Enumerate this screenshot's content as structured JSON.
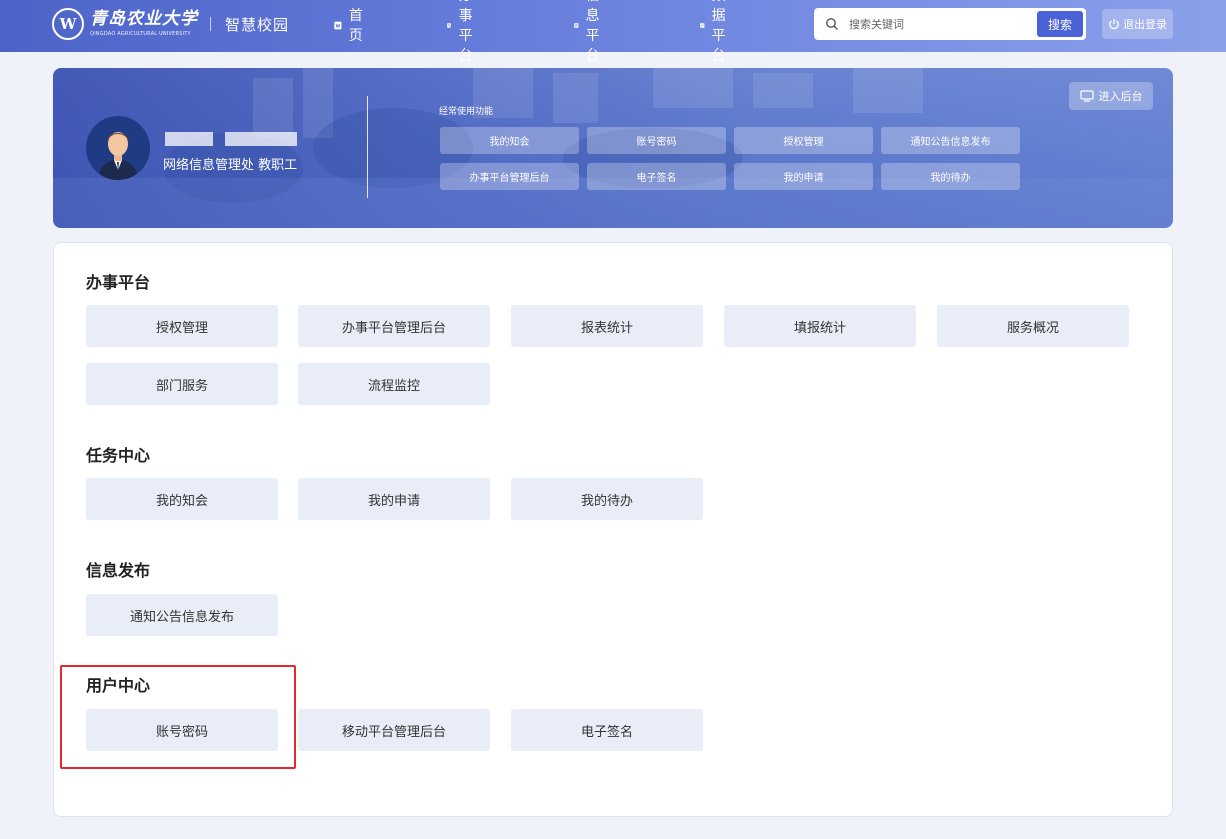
{
  "header": {
    "logo_cn": "青岛农业大学",
    "logo_en": "QINGDAO AGRICULTURAL UNIVERSITY",
    "system_name": "智慧校园",
    "nav": [
      {
        "label": "首页",
        "icon": "home-icon"
      },
      {
        "label": "办事平台",
        "icon": "edit-document-icon"
      },
      {
        "label": "信息平台",
        "icon": "info-document-icon"
      },
      {
        "label": "数据平台",
        "icon": "data-chart-icon"
      }
    ],
    "search": {
      "placeholder": "搜索关键词",
      "button_label": "搜索"
    },
    "logout_label": "退出登录"
  },
  "banner": {
    "user_dept": "网络信息管理处  教职工",
    "quick_title": "经常使用功能",
    "quick_items": [
      "我的知会",
      "账号密码",
      "授权管理",
      "通知公告信息发布",
      "办事平台管理后台",
      "电子签名",
      "我的申请",
      "我的待办"
    ],
    "backend_label": "进入后台"
  },
  "sections": [
    {
      "title": "办事平台",
      "items": [
        "授权管理",
        "办事平台管理后台",
        "报表统计",
        "填报统计",
        "服务概况",
        "部门服务",
        "流程监控"
      ]
    },
    {
      "title": "任务中心",
      "items": [
        "我的知会",
        "我的申请",
        "我的待办"
      ]
    },
    {
      "title": "信息发布",
      "items": [
        "通知公告信息发布"
      ]
    },
    {
      "title": "用户中心",
      "items": [
        "账号密码",
        "移动平台管理后台",
        "电子签名"
      ]
    }
  ],
  "colors": {
    "primary": "#4a62d6",
    "button_bg": "#e9edf8",
    "highlight": "#e3292b"
  }
}
